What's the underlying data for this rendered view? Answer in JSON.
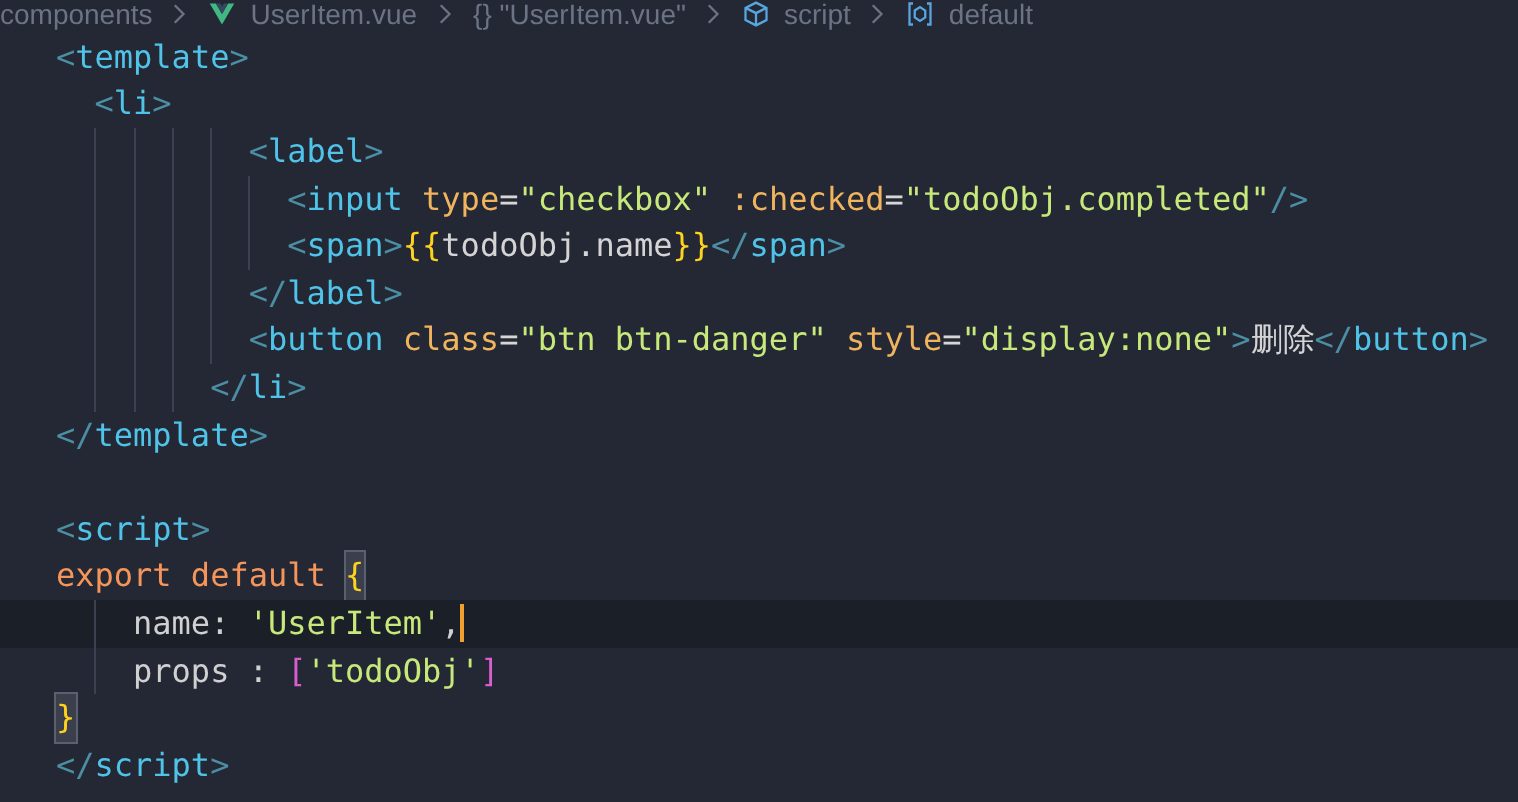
{
  "breadcrumb": [
    {
      "kind": "folder",
      "text": "components"
    },
    {
      "kind": "vue",
      "text": "UserItem.vue"
    },
    {
      "kind": "braces",
      "text": "{} \"UserItem.vue\""
    },
    {
      "kind": "module",
      "text": "script"
    },
    {
      "kind": "variable",
      "text": "default"
    }
  ],
  "blocks": [
    {
      "lines": [
        {
          "tokens": [
            {
              "kind": "punct",
              "text": "<"
            },
            {
              "kind": "tag",
              "text": "template"
            },
            {
              "kind": "punct",
              "text": ">"
            }
          ]
        },
        {
          "tokens": [
            {
              "kind": "punct",
              "text": "  <"
            },
            {
              "kind": "tag",
              "text": "li"
            },
            {
              "kind": "punct",
              "text": ">"
            }
          ]
        },
        {
          "tokens": [
            {
              "kind": "punct",
              "text": "          <"
            },
            {
              "kind": "tag",
              "text": "label"
            },
            {
              "kind": "punct",
              "text": ">"
            }
          ]
        },
        {
          "tokens": [
            {
              "kind": "punct",
              "text": "            <"
            },
            {
              "kind": "tag",
              "text": "input"
            },
            {
              "kind": "attr",
              "text": " type"
            },
            {
              "kind": "op",
              "text": "="
            },
            {
              "kind": "string",
              "text": "\"checkbox\""
            },
            {
              "kind": "attr",
              "text": " :checked"
            },
            {
              "kind": "op",
              "text": "="
            },
            {
              "kind": "string",
              "text": "\"todoObj.completed\""
            },
            {
              "kind": "punct",
              "text": "/>"
            }
          ]
        },
        {
          "tokens": [
            {
              "kind": "punct",
              "text": "            <"
            },
            {
              "kind": "tag",
              "text": "span"
            },
            {
              "kind": "punct",
              "text": ">"
            },
            {
              "kind": "mustache",
              "text": "{{"
            },
            {
              "kind": "text",
              "text": "todoObj.name"
            },
            {
              "kind": "mustache",
              "text": "}}"
            },
            {
              "kind": "punct",
              "text": "</"
            },
            {
              "kind": "tag",
              "text": "span"
            },
            {
              "kind": "punct",
              "text": ">"
            }
          ]
        },
        {
          "tokens": [
            {
              "kind": "punct",
              "text": "          </"
            },
            {
              "kind": "tag",
              "text": "label"
            },
            {
              "kind": "punct",
              "text": ">"
            }
          ]
        },
        {
          "tokens": [
            {
              "kind": "punct",
              "text": "          <"
            },
            {
              "kind": "tag",
              "text": "button"
            },
            {
              "kind": "attr",
              "text": " class"
            },
            {
              "kind": "op",
              "text": "="
            },
            {
              "kind": "string",
              "text": "\"btn btn-danger\""
            },
            {
              "kind": "attr",
              "text": " style"
            },
            {
              "kind": "op",
              "text": "="
            },
            {
              "kind": "string",
              "text": "\"display:none\""
            },
            {
              "kind": "punct",
              "text": ">"
            },
            {
              "kind": "text",
              "text": "删除"
            },
            {
              "kind": "punct",
              "text": "</"
            },
            {
              "kind": "tag",
              "text": "button"
            },
            {
              "kind": "punct",
              "text": ">"
            }
          ]
        },
        {
          "tokens": [
            {
              "kind": "punct",
              "text": "        </"
            },
            {
              "kind": "tag",
              "text": "li"
            },
            {
              "kind": "punct",
              "text": ">"
            }
          ]
        },
        {
          "tokens": [
            {
              "kind": "punct",
              "text": "</"
            },
            {
              "kind": "tag",
              "text": "template"
            },
            {
              "kind": "punct",
              "text": ">"
            }
          ]
        }
      ]
    },
    {
      "lines": [
        {
          "tokens": [
            {
              "kind": "punct",
              "text": "<"
            },
            {
              "kind": "tag",
              "text": "script"
            },
            {
              "kind": "punct",
              "text": ">"
            }
          ]
        },
        {
          "tokens": [
            {
              "kind": "keyword",
              "text": "export default "
            },
            {
              "kind": "brace_match",
              "text": "{"
            }
          ]
        },
        {
          "current": true,
          "cursor": true,
          "tokens": [
            {
              "kind": "prop",
              "text": "    name: "
            },
            {
              "kind": "string",
              "text": "'UserItem'"
            },
            {
              "kind": "prop",
              "text": ","
            }
          ]
        },
        {
          "tokens": [
            {
              "kind": "prop",
              "text": "    props : "
            },
            {
              "kind": "bracket",
              "text": "["
            },
            {
              "kind": "string",
              "text": "'todoObj'"
            },
            {
              "kind": "bracket",
              "text": "]"
            }
          ]
        },
        {
          "tokens": [
            {
              "kind": "brace_match",
              "text": "}"
            }
          ]
        },
        {
          "tokens": [
            {
              "kind": "punct",
              "text": "</"
            },
            {
              "kind": "tag",
              "text": "script"
            },
            {
              "kind": "punct",
              "text": ">"
            }
          ]
        }
      ]
    }
  ]
}
